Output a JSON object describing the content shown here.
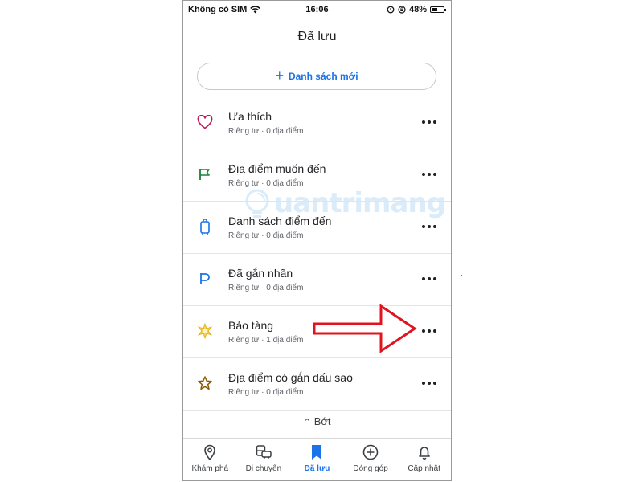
{
  "status_bar": {
    "carrier": "Không có SIM",
    "time": "16:06",
    "battery_text": "48%",
    "battery_level": 0.48,
    "icons": [
      "wifi-icon",
      "alarm-icon",
      "lock-rotation-icon",
      "battery-icon"
    ]
  },
  "title": "Đã lưu",
  "new_list": {
    "icon": "plus-icon",
    "label": "Danh sách mới"
  },
  "lists": [
    {
      "title": "Ưa thích",
      "subtitle": "Riêng tư · 0 địa điểm",
      "icon": "heart-icon",
      "color": "#c2185b"
    },
    {
      "title": "Địa điểm muốn đến",
      "subtitle": "Riêng tư · 0 địa điểm",
      "icon": "flag-icon",
      "color": "#188038"
    },
    {
      "title": "Danh sách điểm đến",
      "subtitle": "Riêng tư · 0 địa điểm",
      "icon": "luggage-icon",
      "color": "#1a73e8"
    },
    {
      "title": "Đã gắn nhãn",
      "subtitle": "Riêng tư · 0 địa điểm",
      "icon": "label-flag-icon",
      "color": "#1a73e8"
    },
    {
      "title": "Bảo tàng",
      "subtitle": "Riêng tư · 1 địa điểm",
      "icon": "sparkle-icon",
      "color": "#f4c542"
    },
    {
      "title": "Địa điểm có gắn dấu sao",
      "subtitle": "Riêng tư · 0 địa điểm",
      "icon": "star-icon",
      "color": "#8a5a00"
    }
  ],
  "collapse": {
    "icon": "chevron-up-icon",
    "label": "Bớt"
  },
  "bottom_nav": [
    {
      "label": "Khám phá",
      "icon": "location-pin-icon",
      "active": false
    },
    {
      "label": "Di chuyển",
      "icon": "commute-icon",
      "active": false
    },
    {
      "label": "Đã lưu",
      "icon": "bookmark-icon",
      "active": true
    },
    {
      "label": "Đóng góp",
      "icon": "add-circle-icon",
      "active": false
    },
    {
      "label": "Cập nhật",
      "icon": "bell-icon",
      "active": false
    }
  ],
  "watermark": {
    "text": "uantrimang"
  },
  "colors": {
    "accent": "#1a73e8",
    "annotation_arrow": "#e0141e",
    "divider": "#e4e4e4"
  }
}
